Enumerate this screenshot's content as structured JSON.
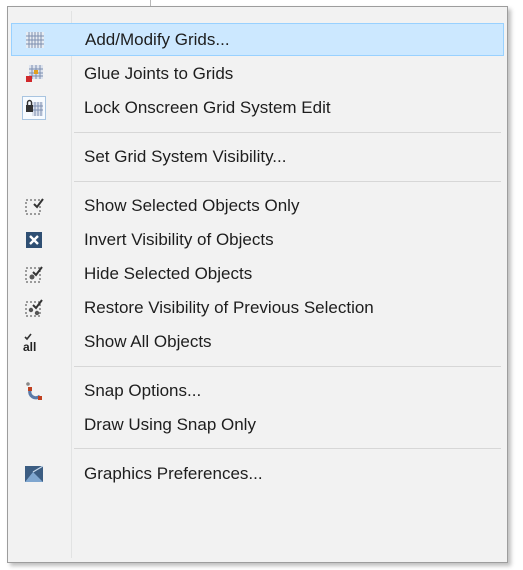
{
  "menu": {
    "items": [
      {
        "label": "Add/Modify Grids...",
        "icon": "grid-icon"
      },
      {
        "label": "Glue Joints to Grids",
        "icon": "glue-joints-icon"
      },
      {
        "label": "Lock Onscreen Grid System Edit",
        "icon": "lock-grid-icon"
      },
      {
        "label": "Set Grid System Visibility...",
        "icon": ""
      },
      {
        "label": "Show Selected Objects Only",
        "icon": "show-selected-icon"
      },
      {
        "label": "Invert Visibility of Objects",
        "icon": "invert-visibility-icon"
      },
      {
        "label": "Hide Selected Objects",
        "icon": "hide-selected-icon"
      },
      {
        "label": "Restore Visibility of Previous Selection",
        "icon": "restore-visibility-icon"
      },
      {
        "label": "Show All Objects",
        "icon": "show-all-icon",
        "icon_text": "all"
      },
      {
        "label": "Snap Options...",
        "icon": "snap-magnet-icon"
      },
      {
        "label": "Draw Using Snap Only",
        "icon": ""
      },
      {
        "label": "Graphics Preferences...",
        "icon": "graphics-preferences-icon"
      }
    ],
    "highlighted_index": 0
  },
  "colors": {
    "highlight_bg": "#cce8ff",
    "highlight_border": "#99d1ff",
    "menu_bg": "#f2f2f2"
  }
}
